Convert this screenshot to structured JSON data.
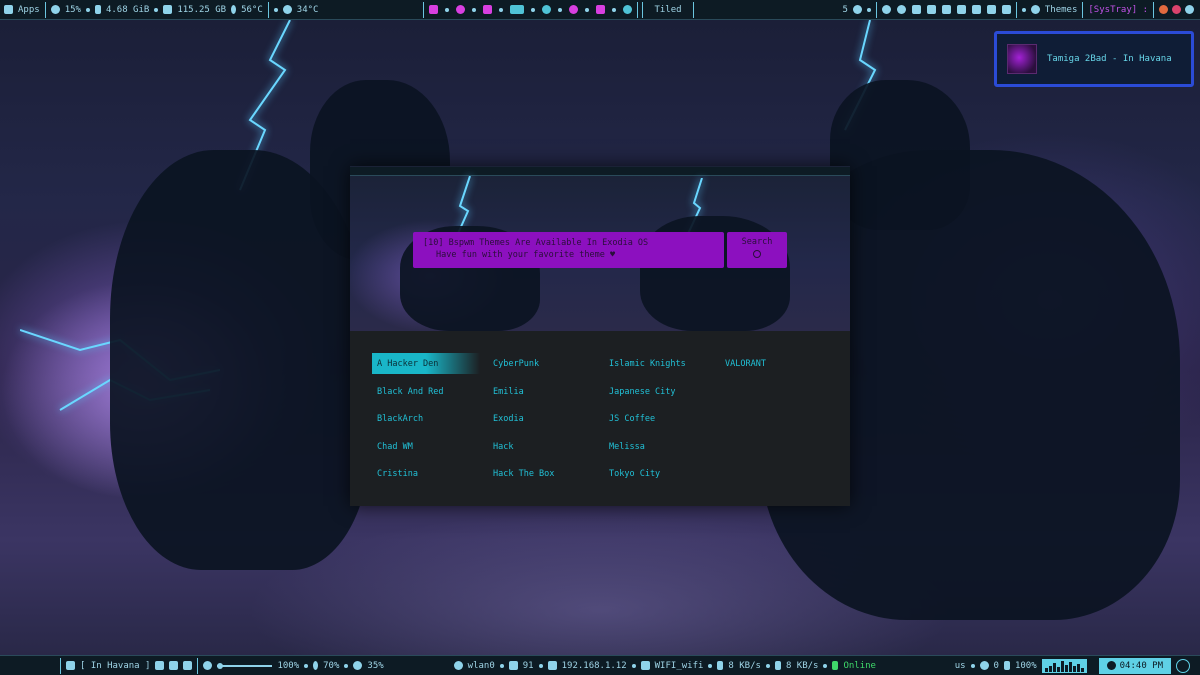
{
  "top_bar": {
    "apps_label": "Apps",
    "cpu": "15%",
    "ram": "4.68 GiB",
    "disk": "115.25 GB",
    "cpu_temp": "56°C",
    "weather_temp": "34°C",
    "layout": "Tiled",
    "workspace": "5",
    "themes_label": "Themes",
    "systray_label": "[SysTray] :"
  },
  "notification": {
    "text": "Tamiga 2Bad - In Havana"
  },
  "window": {
    "message_line1": "[10] Bspwm Themes Are Available In Exodia OS",
    "message_line2": "Have fun with your favorite theme ♥",
    "search_label": "Search",
    "themes": [
      "A Hacker Den",
      "Black And Red",
      "BlackArch",
      "Chad WM",
      "Cristina",
      "CyberPunk",
      "Emilia",
      "Exodia",
      "Hack",
      "Hack The Box",
      "Islamic Knights",
      "Japanese City",
      "JS Coffee",
      "Melissa",
      "Tokyo City",
      "VALORANT"
    ],
    "selected_theme": "A Hacker Den"
  },
  "bottom_bar": {
    "song": "[ In Havana ]",
    "volume": "100%",
    "mic": "70%",
    "brightness": "35%",
    "interface": "wlan0",
    "signal": "91",
    "ip": "192.168.1.12",
    "ssid": "WIFI_wifi",
    "down": "8 KB/s",
    "up": "8 KB/s",
    "status": "Online",
    "keyboard": "us",
    "battery": "100%",
    "time": "04:40 PM",
    "github_count": "0"
  }
}
